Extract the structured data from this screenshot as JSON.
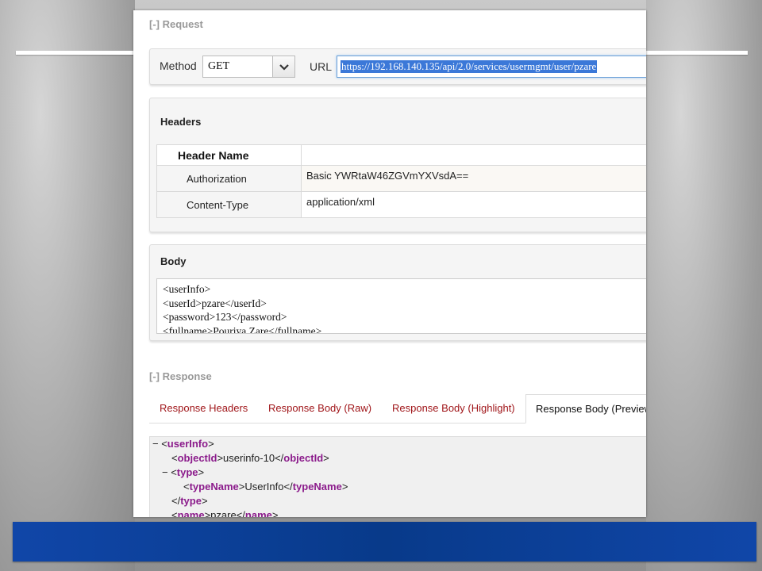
{
  "request": {
    "title": "[-] Request",
    "method_label": "Method",
    "method_value": "GET",
    "url_label": "URL",
    "url_value": "https://192.168.140.135/api/2.0/services/usermgmt/user/pzare"
  },
  "headers": {
    "title": "Headers",
    "column_name": "Header Name",
    "column_value": "",
    "rows": [
      {
        "name": "Authorization",
        "value": "Basic YWRtaW46ZGVmYXVsdA=="
      },
      {
        "name": "Content-Type",
        "value": "application/xml"
      }
    ]
  },
  "body": {
    "title": "Body",
    "lines": [
      "<userInfo>",
      "<userId>pzare</userId>",
      "<password>123</password>",
      "<fullname>Pouriya Zare</fullname>"
    ]
  },
  "response": {
    "title": "[-] Response",
    "tabs": [
      "Response Headers",
      "Response Body (Raw)",
      "Response Body (Highlight)",
      "Response Body (Preview)"
    ],
    "active_tab": "Response Body (Preview)",
    "preview": [
      {
        "prefix": "− <",
        "tag": "userInfo",
        "text": "",
        "close": ">"
      },
      {
        "prefix": "<",
        "tag": "objectId",
        "text": "userinfo-10",
        "close_tag": "objectId"
      },
      {
        "prefix": "− <",
        "tag": "type",
        "text": "",
        "close": ">"
      },
      {
        "prefix": "<",
        "tag": "typeName",
        "text": "UserInfo",
        "close_tag": "typeName"
      },
      {
        "prefix": "</",
        "tag": "type",
        "text": "",
        "close": ">"
      },
      {
        "prefix": "<",
        "tag": "name",
        "text": "pzare",
        "close_tag": "name"
      }
    ]
  },
  "colors": {
    "tab_link": "#a0161a",
    "xml_tag": "#8b1b8b",
    "url_selection": "#3b78d8",
    "footer_bar": "#0b3f95"
  }
}
